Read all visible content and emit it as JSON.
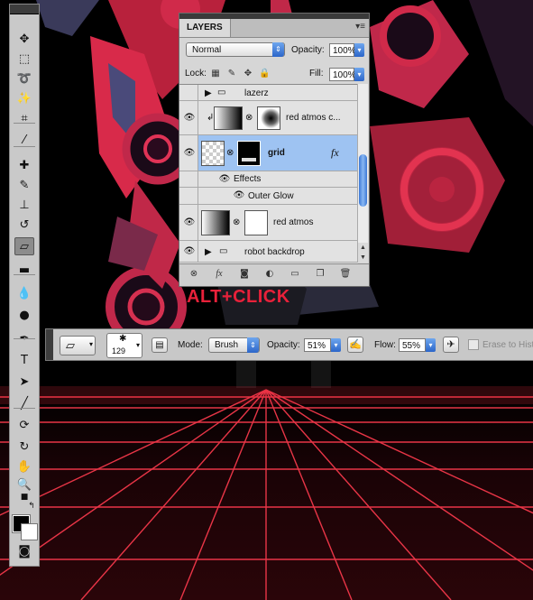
{
  "tools": [
    {
      "name": "move-tool-icon",
      "glyph": "✥"
    },
    {
      "name": "marquee-tool-icon",
      "glyph": "⬚"
    },
    {
      "name": "lasso-tool-icon",
      "glyph": "➰"
    },
    {
      "name": "magic-wand-tool-icon",
      "glyph": "✨"
    },
    {
      "name": "crop-tool-icon",
      "glyph": "⌗"
    },
    {
      "name": "eyedropper-tool-icon",
      "glyph": "⁄"
    },
    {
      "name": "healing-brush-tool-icon",
      "glyph": "✚"
    },
    {
      "name": "brush-tool-icon",
      "glyph": "✎"
    },
    {
      "name": "clone-stamp-tool-icon",
      "glyph": "⊥"
    },
    {
      "name": "history-brush-tool-icon",
      "glyph": "↺"
    },
    {
      "name": "eraser-tool-icon",
      "glyph": "▱"
    },
    {
      "name": "gradient-tool-icon",
      "glyph": "▬"
    },
    {
      "name": "blur-tool-icon",
      "glyph": "💧"
    },
    {
      "name": "dodge-tool-icon",
      "glyph": "●"
    },
    {
      "name": "pen-tool-icon",
      "glyph": "✒"
    },
    {
      "name": "type-tool-icon",
      "glyph": "T"
    },
    {
      "name": "path-selection-tool-icon",
      "glyph": "➤"
    },
    {
      "name": "line-tool-icon",
      "glyph": "╱"
    },
    {
      "name": "3d-rotate-tool-icon",
      "glyph": "⟳"
    },
    {
      "name": "3d-orbit-tool-icon",
      "glyph": "↻"
    },
    {
      "name": "hand-tool-icon",
      "glyph": "✋"
    },
    {
      "name": "zoom-tool-icon",
      "glyph": "🔍"
    }
  ],
  "layers_panel": {
    "tab": "LAYERS",
    "menu_glyph": "▾≡",
    "blend_mode": "Normal",
    "opacity_label": "Opacity:",
    "opacity_value": "100%",
    "lock_label": "Lock:",
    "fill_label": "Fill:",
    "fill_value": "100%",
    "layers": [
      {
        "name": "lazerz",
        "kind": "group"
      },
      {
        "name": "red atmos c...",
        "kind": "adjustment"
      },
      {
        "name": "grid",
        "kind": "layer",
        "selected": true
      },
      {
        "name": "Effects",
        "kind": "effects"
      },
      {
        "name": "Outer Glow",
        "kind": "effect"
      },
      {
        "name": "red atmos",
        "kind": "adjustment"
      },
      {
        "name": "robot backdrop",
        "kind": "group"
      }
    ],
    "fx_glyph": "fx",
    "footer_icons": [
      "link-layers-icon",
      "add-style-icon",
      "add-mask-icon",
      "adjustment-layer-icon",
      "new-group-icon",
      "new-layer-icon",
      "delete-layer-icon"
    ]
  },
  "annotation": "ALT+CLICK",
  "options_bar": {
    "brush_size": "129",
    "mode_label": "Mode:",
    "mode_value": "Brush",
    "opacity_label": "Opacity:",
    "opacity_value": "51%",
    "flow_label": "Flow:",
    "flow_value": "55%",
    "erase_label": "Erase to Histo"
  },
  "colors": {
    "accent_red": "#e8213a",
    "selection_blue": "#9ec3f2"
  }
}
